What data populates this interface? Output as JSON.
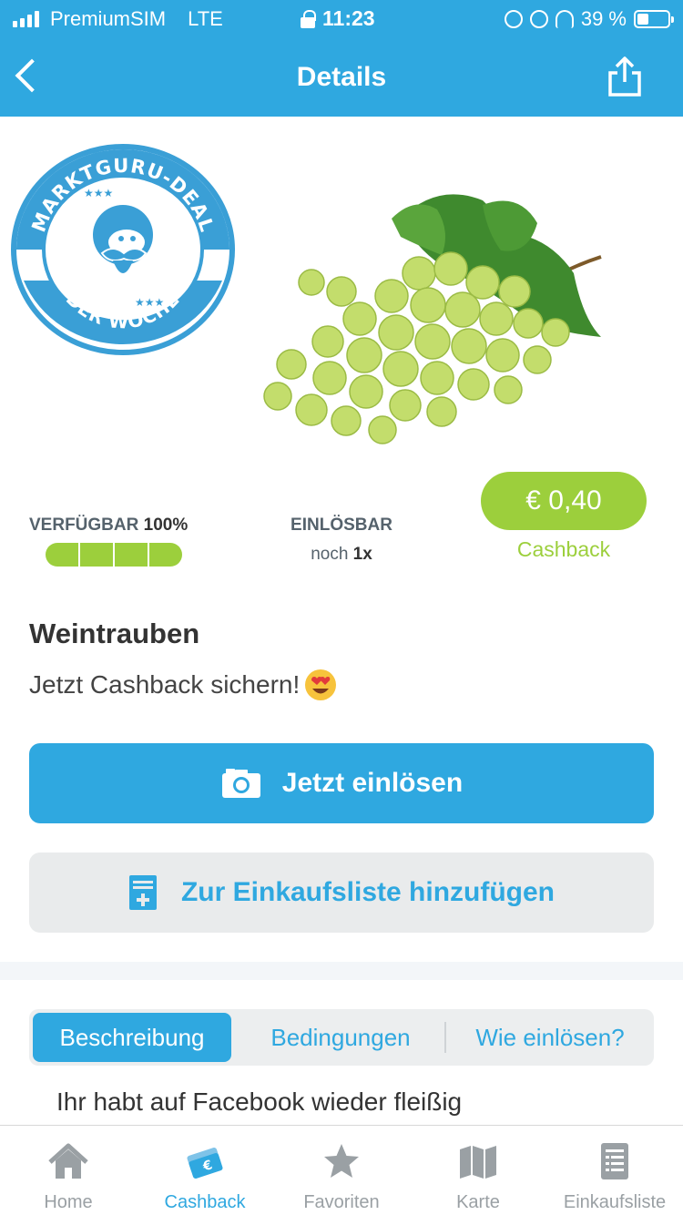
{
  "status_bar": {
    "carrier": "PremiumSIM",
    "network": "LTE",
    "time": "11:23",
    "battery": "39 %"
  },
  "header": {
    "title": "Details"
  },
  "badge": {
    "top_text": "MARKTGURU-DEAL",
    "bottom_text": "DER WOCHE"
  },
  "stats": {
    "available_label": "VERFÜGBAR",
    "available_value": "100%",
    "available_fraction": 1.0,
    "redeemable_label": "EINLÖSBAR",
    "redeemable_prefix": "noch",
    "redeemable_value": "1x"
  },
  "price": {
    "amount": "€ 0,40",
    "label": "Cashback"
  },
  "product": {
    "name": "Weintrauben",
    "subtitle": "Jetzt Cashback sichern!"
  },
  "actions": {
    "redeem_label": "Jetzt einlösen",
    "add_to_list_label": "Zur Einkaufsliste hinzufügen"
  },
  "segments": {
    "tabs": [
      {
        "label": "Beschreibung",
        "active": true
      },
      {
        "label": "Bedingungen",
        "active": false
      },
      {
        "label": "Wie einlösen?",
        "active": false
      }
    ]
  },
  "description": {
    "text": "Ihr habt auf Facebook wieder fleißig"
  },
  "tabbar": {
    "items": [
      {
        "label": "Home",
        "icon": "home-icon"
      },
      {
        "label": "Cashback",
        "icon": "cashback-icon"
      },
      {
        "label": "Favoriten",
        "icon": "star-icon"
      },
      {
        "label": "Karte",
        "icon": "map-icon"
      },
      {
        "label": "Einkaufsliste",
        "icon": "list-icon"
      }
    ],
    "active_index": 1
  },
  "colors": {
    "primary": "#2fa8e0",
    "accent_green": "#9ccf3c",
    "inactive": "#9aa0a4"
  }
}
